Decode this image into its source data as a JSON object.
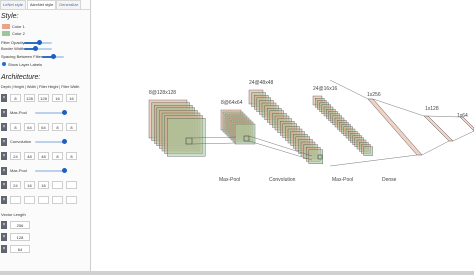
{
  "tabs": [
    "LeNet style",
    "AlexNet style",
    "Generalize"
  ],
  "style": {
    "heading": "Style:",
    "color1_label": "Color 1",
    "color2_label": "Color 2",
    "color1": "#e6a58a",
    "color2": "#9ac89a",
    "filter_opacity_label": "Filter Opacity",
    "filter_opacity": 0.55,
    "border_width_label": "Border Width",
    "border_width": 0.4,
    "spacing_label": "Spacing Between Filters",
    "spacing": 0.5,
    "show_labels_label": "Show Layer Labels"
  },
  "architecture": {
    "heading": "Architecture:",
    "header": "Depth | Height | Width | Filter Height | Filter Width",
    "delete_glyph": "×",
    "rows": [
      {
        "values": [
          "8",
          "128",
          "128",
          "16",
          "16"
        ],
        "slider_label": ""
      },
      {
        "values": [],
        "slider_label": "Max-Pool"
      },
      {
        "values": [
          "8",
          "64",
          "64",
          "8",
          "8"
        ],
        "slider_label": ""
      },
      {
        "values": [],
        "slider_label": "Convolution"
      },
      {
        "values": [
          "24",
          "48",
          "48",
          "8",
          "8"
        ],
        "slider_label": ""
      },
      {
        "values": [],
        "slider_label": "Max-Pool"
      },
      {
        "values": [
          "24",
          "16",
          "16",
          "",
          ""
        ],
        "slider_label": ""
      },
      {
        "values": [
          "",
          "",
          "",
          "",
          ""
        ],
        "slider_label": ""
      }
    ],
    "vector_heading": "Vector Length",
    "vector_values": [
      "256",
      "128",
      "64"
    ]
  },
  "diagram": {
    "layer_labels": [
      "8@128x128",
      "8@64x64",
      "24@48x48",
      "24@16x16",
      "1x256",
      "1x128",
      "1x64"
    ],
    "op_labels": [
      "Max-Pool",
      "Convolution",
      "Max-Pool",
      "Dense"
    ]
  }
}
